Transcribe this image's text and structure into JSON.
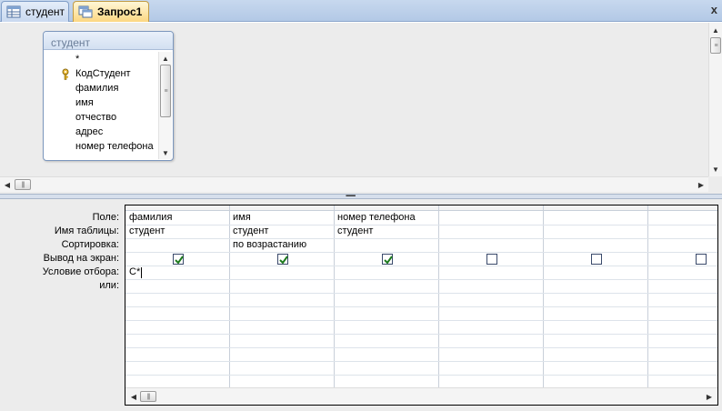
{
  "tabs": [
    {
      "label": "студент",
      "icon": "table-icon",
      "active": false
    },
    {
      "label": "Запрос1",
      "icon": "query-icon",
      "active": true
    }
  ],
  "close_glyph": "x",
  "field_list": {
    "title": "студент",
    "fields": [
      "*",
      "КодСтудент",
      "фамилия",
      "имя",
      "отчество",
      "адрес",
      "номер телефона"
    ],
    "key_field": "КодСтудент"
  },
  "grid": {
    "row_labels": [
      "Поле:",
      "Имя таблицы:",
      "Сортировка:",
      "Вывод на экран:",
      "Условие отбора:",
      "или:"
    ],
    "columns": [
      {
        "field": "фамилия",
        "table": "студент",
        "sort": "",
        "show": true,
        "criteria": "С*",
        "or": ""
      },
      {
        "field": "имя",
        "table": "студент",
        "sort": "по возрастанию",
        "show": true,
        "criteria": "",
        "or": ""
      },
      {
        "field": "номер телефона",
        "table": "студент",
        "sort": "",
        "show": true,
        "criteria": "",
        "or": ""
      },
      {
        "field": "",
        "table": "",
        "sort": "",
        "show": false,
        "criteria": "",
        "or": ""
      },
      {
        "field": "",
        "table": "",
        "sort": "",
        "show": false,
        "criteria": "",
        "or": ""
      },
      {
        "field": "",
        "table": "",
        "sort": "",
        "show": false,
        "criteria": "",
        "or": ""
      }
    ]
  },
  "colors": {
    "active_tab": "#fcd782",
    "checkmark": "#1c7a1c",
    "grid_border": "#000000"
  }
}
